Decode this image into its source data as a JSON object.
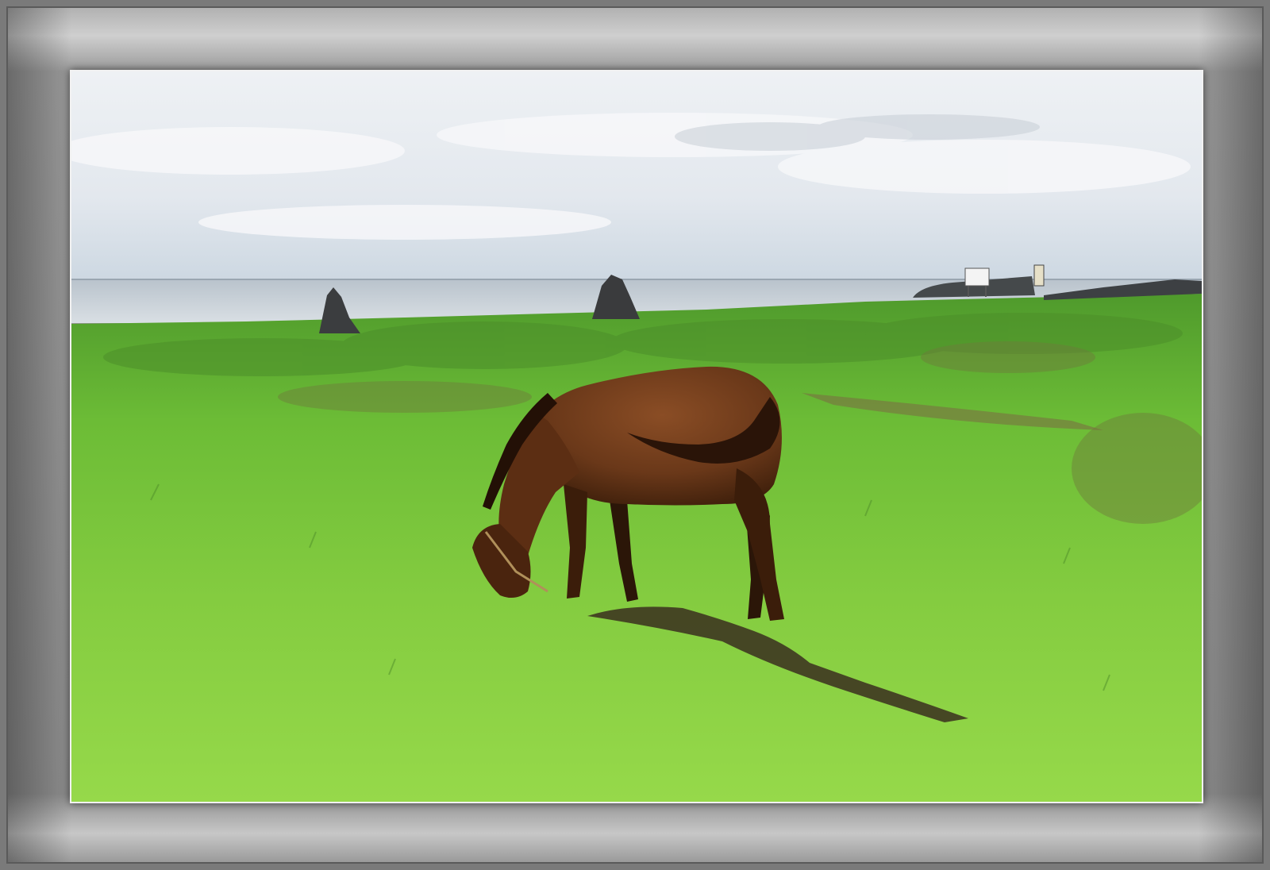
{
  "scene": {
    "subject": "horse",
    "colors": {
      "frame": "#9a9a9a",
      "mat_border": "#f2f2f2",
      "sky_top": "#e9edf1",
      "sky_bottom": "#cfd9e2",
      "sea": "#c8d0d8",
      "grass_far": "#6fbf3a",
      "grass_near": "#8fd34a",
      "horse_coat": "#6b3a1c",
      "horse_dark": "#2b1608",
      "rock": "#3b3d3f"
    }
  }
}
